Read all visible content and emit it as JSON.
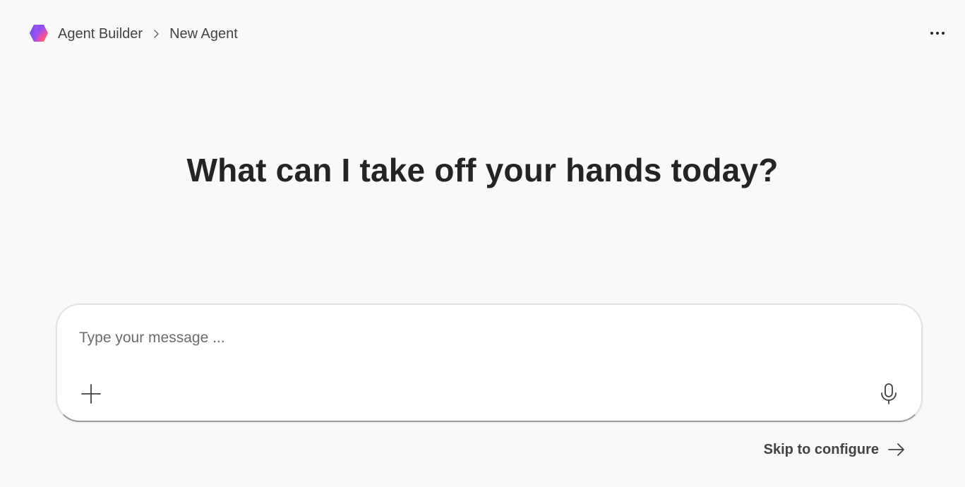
{
  "header": {
    "logo_icon": "agent-builder-hexagon-logo",
    "breadcrumb": [
      {
        "label": "Agent Builder"
      },
      {
        "label": "New Agent"
      }
    ],
    "separator_icon": "chevron-right-icon",
    "more_icon": "more-horizontal-icon"
  },
  "main": {
    "headline": "What can I take off your hands today?"
  },
  "composer": {
    "value": "",
    "placeholder": "Type your message ...",
    "add_icon": "plus-icon",
    "mic_icon": "microphone-icon"
  },
  "footer": {
    "skip_label": "Skip to configure",
    "skip_icon": "arrow-right-icon"
  },
  "colors": {
    "background": "#f9f9f9",
    "text": "#242424",
    "logo_gradient": [
      "#4f6bed",
      "#a259ff",
      "#ff5b8a",
      "#ff8a4f"
    ]
  }
}
